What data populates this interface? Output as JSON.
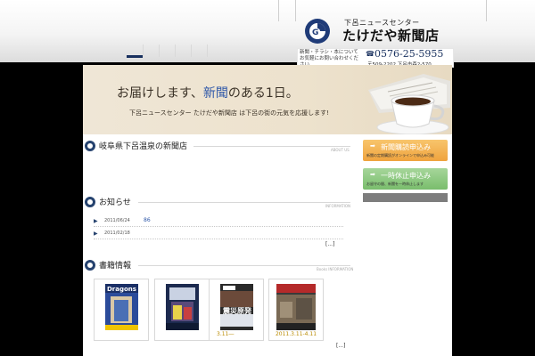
{
  "header": {
    "logo_subtitle": "下呂ニュースセンター",
    "logo_name": "たけだや新聞店",
    "contact_note": "新聞・チラシ・本について お気軽にお問い合わせください",
    "phone_icon": "☎",
    "phone": "0576-25-5955",
    "address": "〒509-2202 下呂市森2-570"
  },
  "hero": {
    "title_before": "お届けします、",
    "title_highlight": "新聞",
    "title_after": "のある1日。",
    "subtitle": "下呂ニュースセンター たけだや新聞店 は下呂の街の元気を応援します!",
    "accent_color": "#2c56a8"
  },
  "sections": {
    "shop": {
      "title": "岐阜県下呂温泉の新聞店",
      "sub": "ABOUT US"
    },
    "news": {
      "title": "お知らせ",
      "sub": "INFORMATION",
      "items": [
        {
          "date": "2011/06/24",
          "text": "86"
        },
        {
          "date": "2011/02/18",
          "text": ""
        }
      ],
      "more": "[...]"
    },
    "books": {
      "title": "書籍情報",
      "sub": "Books INFORMATION",
      "items": [
        {
          "cover_title": "Dragons",
          "caption": ""
        },
        {
          "cover_title": "",
          "caption": ""
        },
        {
          "cover_title": "震災原発",
          "caption": "3.11―"
        },
        {
          "cover_title": "",
          "caption": "2011.3.11-4.11"
        }
      ],
      "more": "[...]"
    }
  },
  "sidebar": {
    "subscribe": {
      "label": "新聞購読申込み",
      "note": "新聞の定期購読がオンラインで申込み可能"
    },
    "pause": {
      "label": "一時休止申込み",
      "note": "お留守の間、新聞を一時休止します"
    }
  },
  "colors": {
    "navy": "#26436f",
    "orange": "#efa33e",
    "green": "#79bd6c"
  }
}
